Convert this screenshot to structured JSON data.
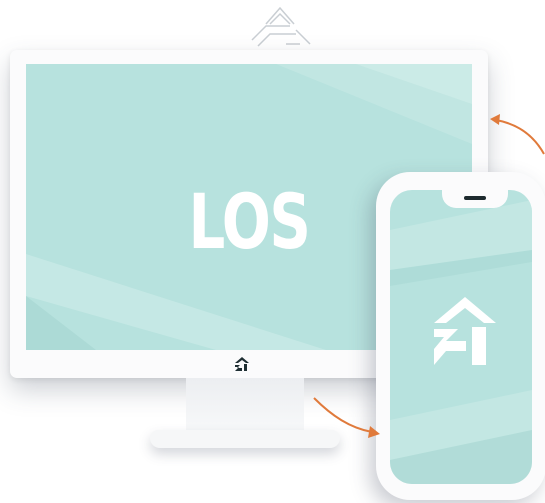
{
  "screen": {
    "title": "LOS"
  },
  "colors": {
    "screen": "#b7e2de",
    "frame": "#fbfbfc",
    "arrow": "#e07a3b",
    "logo": "#ffffff",
    "chin_logo": "#1f2f33"
  },
  "icons": {
    "top_logo": "brand-logo-outline-icon",
    "chin_logo": "brand-logo-icon",
    "phone_logo": "brand-logo-icon",
    "arrows": "curved-arrow-icon"
  }
}
